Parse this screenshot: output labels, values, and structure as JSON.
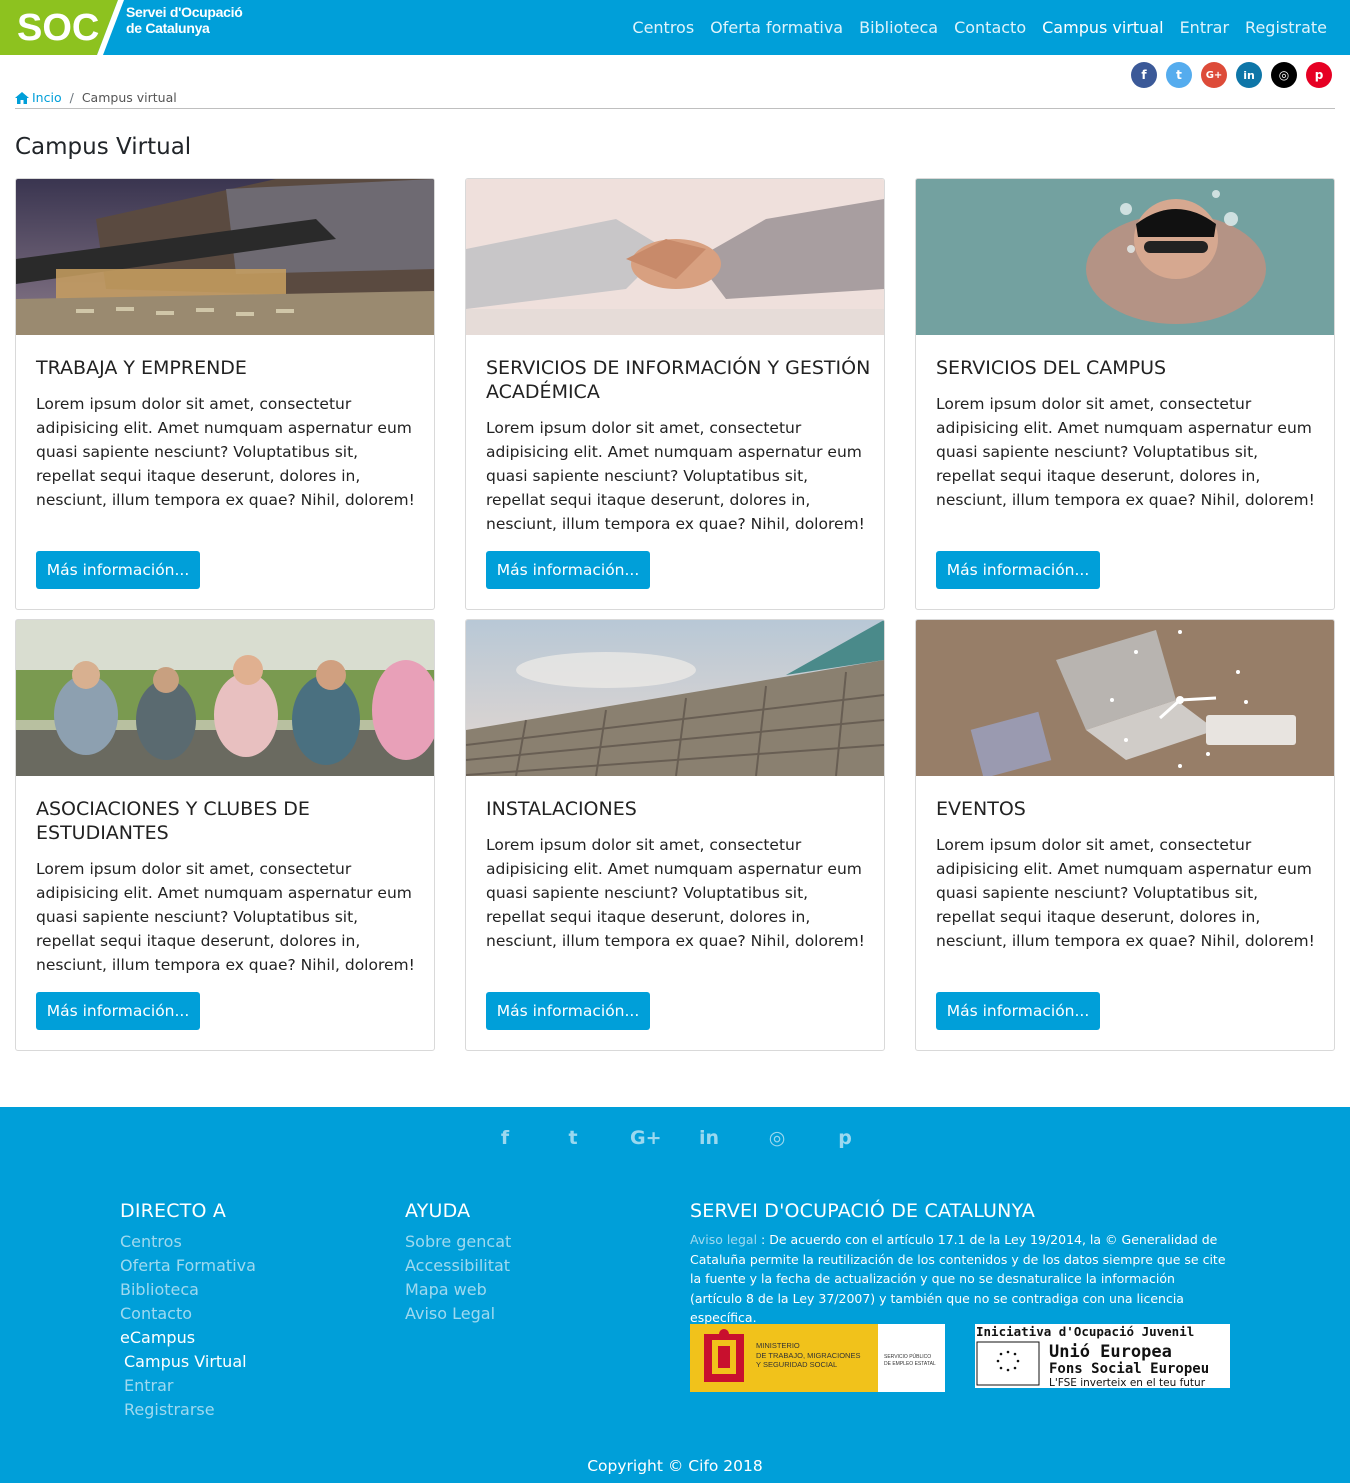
{
  "header": {
    "logo_abbr": "SOC",
    "logo_line1": "Servei d'Ocupació",
    "logo_line2": "de Catalunya",
    "nav": [
      "Centros",
      "Oferta formativa",
      "Biblioteca",
      "Contacto",
      "Campus virtual",
      "Entrar",
      "Registrate"
    ],
    "active_nav": "Campus virtual"
  },
  "social": [
    {
      "icon": "facebook-icon",
      "glyph": "f",
      "color": "#3b5998"
    },
    {
      "icon": "twitter-icon",
      "glyph": "t",
      "color": "#55acee"
    },
    {
      "icon": "google-plus-icon",
      "glyph": "G+",
      "color": "#dd4b39"
    },
    {
      "icon": "linkedin-icon",
      "glyph": "in",
      "color": "#0e76a8"
    },
    {
      "icon": "instagram-icon",
      "glyph": "◎",
      "color": "#000000"
    },
    {
      "icon": "pinterest-icon",
      "glyph": "p",
      "color": "#e60023"
    }
  ],
  "breadcrumb": {
    "home": "Incio",
    "separator": "/",
    "current": "Campus virtual"
  },
  "page_title": "Campus Virtual",
  "cards": [
    {
      "title": "TRABAJA Y EMPRENDE",
      "text": "Lorem ipsum dolor sit amet, consectetur adipisicing elit. Amet numquam aspernatur eum quasi sapiente nesciunt? Voluptatibus sit, repellat sequi itaque deserunt, dolores in, nesciunt, illum tempora ex quae? Nihil, dolorem!",
      "button": "Más información..."
    },
    {
      "title": "SERVICIOS DE INFORMACIÓN Y GESTIÓN ACADÉMICA",
      "text": "Lorem ipsum dolor sit amet, consectetur adipisicing elit. Amet numquam aspernatur eum quasi sapiente nesciunt? Voluptatibus sit, repellat sequi itaque deserunt, dolores in, nesciunt, illum tempora ex quae? Nihil, dolorem!",
      "button": "Más información..."
    },
    {
      "title": "SERVICIOS DEL CAMPUS",
      "text": "Lorem ipsum dolor sit amet, consectetur adipisicing elit. Amet numquam aspernatur eum quasi sapiente nesciunt? Voluptatibus sit, repellat sequi itaque deserunt, dolores in, nesciunt, illum tempora ex quae? Nihil, dolorem!",
      "button": "Más información..."
    },
    {
      "title": "ASOCIACIONES Y CLUBES DE ESTUDIANTES",
      "text": "Lorem ipsum dolor sit amet, consectetur adipisicing elit. Amet numquam aspernatur eum quasi sapiente nesciunt? Voluptatibus sit, repellat sequi itaque deserunt, dolores in, nesciunt, illum tempora ex quae? Nihil, dolorem!",
      "button": "Más información..."
    },
    {
      "title": "INSTALACIONES",
      "text": "Lorem ipsum dolor sit amet, consectetur adipisicing elit. Amet numquam aspernatur eum quasi sapiente nesciunt? Voluptatibus sit, repellat sequi itaque deserunt, dolores in, nesciunt, illum tempora ex quae? Nihil, dolorem!",
      "button": "Más información..."
    },
    {
      "title": "EVENTOS",
      "text": "Lorem ipsum dolor sit amet, consectetur adipisicing elit. Amet numquam aspernatur eum quasi sapiente nesciunt? Voluptatibus sit, repellat sequi itaque deserunt, dolores in, nesciunt, illum tempora ex quae? Nihil, dolorem!",
      "button": "Más información..."
    }
  ],
  "footer": {
    "social_glyphs": [
      "f",
      "t",
      "G+",
      "in",
      "◎",
      "p"
    ],
    "col1": {
      "heading": "DIRECTO A",
      "links": [
        "Centros",
        "Oferta Formativa",
        "Biblioteca",
        "Contacto"
      ],
      "ecampus": "eCampus",
      "sub_active": "Campus Virtual",
      "sublinks": [
        "Entrar",
        "Registrarse"
      ]
    },
    "col2": {
      "heading": "AYUDA",
      "links": [
        "Sobre gencat",
        "Accessibilitat",
        "Mapa web",
        "Aviso Legal"
      ]
    },
    "col3": {
      "heading": "SERVEI D'OCUPACIÓ DE CATALUNYA",
      "legal_link": "Aviso legal",
      "legal_text": " : De acuerdo con el artículo 17.1 de la Ley 19/2014, la © Generalidad de Cataluña permite la reutilización de los contenidos y de los datos siempre que se cite la fuente y la fecha de actualización y que no se desnaturalice la información (artículo 8 de la Ley 37/2007) y también que no se contradiga con una licencia específica."
    },
    "badge_ministry": {
      "line1": "MINISTERIO",
      "line2": "DE TRABAJO, MIGRACIONES",
      "line3": "Y SEGURIDAD SOCIAL",
      "right1": "SERVICIO PÚBLICO",
      "right2": "DE EMPLEO ESTATAL"
    },
    "badge_eu": {
      "line1": "Iniciativa d'Ocupació Juvenil",
      "line2": "Unió Europea",
      "line3": "Fons Social Europeu",
      "line4": "L'FSE inverteix en el teu futur"
    },
    "copyright": "Copyright © Cifo 2018"
  },
  "colors": {
    "brand_blue": "#009fd9",
    "brand_green": "#8dc21f"
  }
}
